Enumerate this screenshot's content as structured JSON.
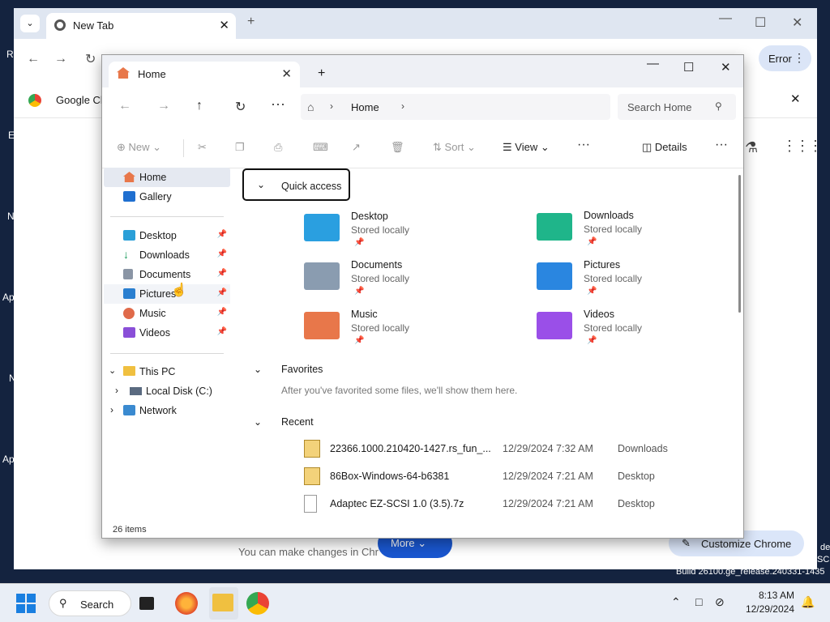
{
  "desktop": {
    "left_fragments": [
      "Re",
      "E",
      "N",
      "Ap",
      "N",
      "Ap"
    ],
    "build_lines": [
      "de",
      "SC",
      "Build 26100.ge_release.240331-1435"
    ]
  },
  "chrome": {
    "tab_title": "New Tab",
    "bookmark_label": "Google Ch",
    "error_label": "Error",
    "ntp_text": "You can make changes in Chr",
    "more_label": "More",
    "customize_label": "Customize Chrome"
  },
  "explorer": {
    "tab_title": "Home",
    "breadcrumb": "Home",
    "search_placeholder": "Search Home",
    "toolbar": {
      "new_label": "New",
      "sort_label": "Sort",
      "view_label": "View",
      "details_label": "Details"
    },
    "sidebar": {
      "top": [
        {
          "label": "Home",
          "icon": "home-icon",
          "color": "#e8774a"
        },
        {
          "label": "Gallery",
          "icon": "gallery-icon",
          "color": "#1f6fd0"
        }
      ],
      "pinned": [
        {
          "label": "Desktop",
          "icon": "desktop-icon",
          "color": "#2a9fd8"
        },
        {
          "label": "Downloads",
          "icon": "downloads-icon",
          "color": "#1a9a5a"
        },
        {
          "label": "Documents",
          "icon": "documents-icon",
          "color": "#8a95a5"
        },
        {
          "label": "Pictures",
          "icon": "pictures-icon",
          "color": "#2a7fd0"
        },
        {
          "label": "Music",
          "icon": "music-icon",
          "color": "#e06a4a"
        },
        {
          "label": "Videos",
          "icon": "videos-icon",
          "color": "#8a4fd8"
        }
      ],
      "tree": [
        {
          "label": "This PC",
          "icon": "this-pc-icon"
        },
        {
          "label": "Local Disk (C:)",
          "icon": "drive-icon"
        },
        {
          "label": "Network",
          "icon": "network-icon"
        }
      ]
    },
    "quick_access": {
      "title": "Quick access",
      "items": [
        {
          "name": "Desktop",
          "status": "Stored locally",
          "icon": "desktop-folder-icon",
          "color": "#2a9fe0"
        },
        {
          "name": "Downloads",
          "status": "Stored locally",
          "icon": "downloads-folder-icon",
          "color": "#1fb58a"
        },
        {
          "name": "Documents",
          "status": "Stored locally",
          "icon": "documents-folder-icon",
          "color": "#8a9cb0"
        },
        {
          "name": "Pictures",
          "status": "Stored locally",
          "icon": "pictures-folder-icon",
          "color": "#2a86e0"
        },
        {
          "name": "Music",
          "status": "Stored locally",
          "icon": "music-folder-icon",
          "color": "#e8774a"
        },
        {
          "name": "Videos",
          "status": "Stored locally",
          "icon": "videos-folder-icon",
          "color": "#9a4fe8"
        }
      ]
    },
    "favorites": {
      "title": "Favorites",
      "empty_text": "After you've favorited some files, we'll show them here."
    },
    "recent": {
      "title": "Recent",
      "items": [
        {
          "name": "22366.1000.210420-1427.rs_fun_...",
          "date": "12/29/2024 7:32 AM",
          "location": "Downloads",
          "icon": "iso-file-icon"
        },
        {
          "name": "86Box-Windows-64-b6381",
          "date": "12/29/2024 7:21 AM",
          "location": "Desktop",
          "icon": "zip-file-icon"
        },
        {
          "name": "Adaptec EZ-SCSI 1.0 (3.5).7z",
          "date": "12/29/2024 7:21 AM",
          "location": "Desktop",
          "icon": "file-icon"
        }
      ]
    },
    "status": "26 items"
  },
  "taskbar": {
    "search_label": "Search",
    "time": "8:13 AM",
    "date": "12/29/2024"
  }
}
